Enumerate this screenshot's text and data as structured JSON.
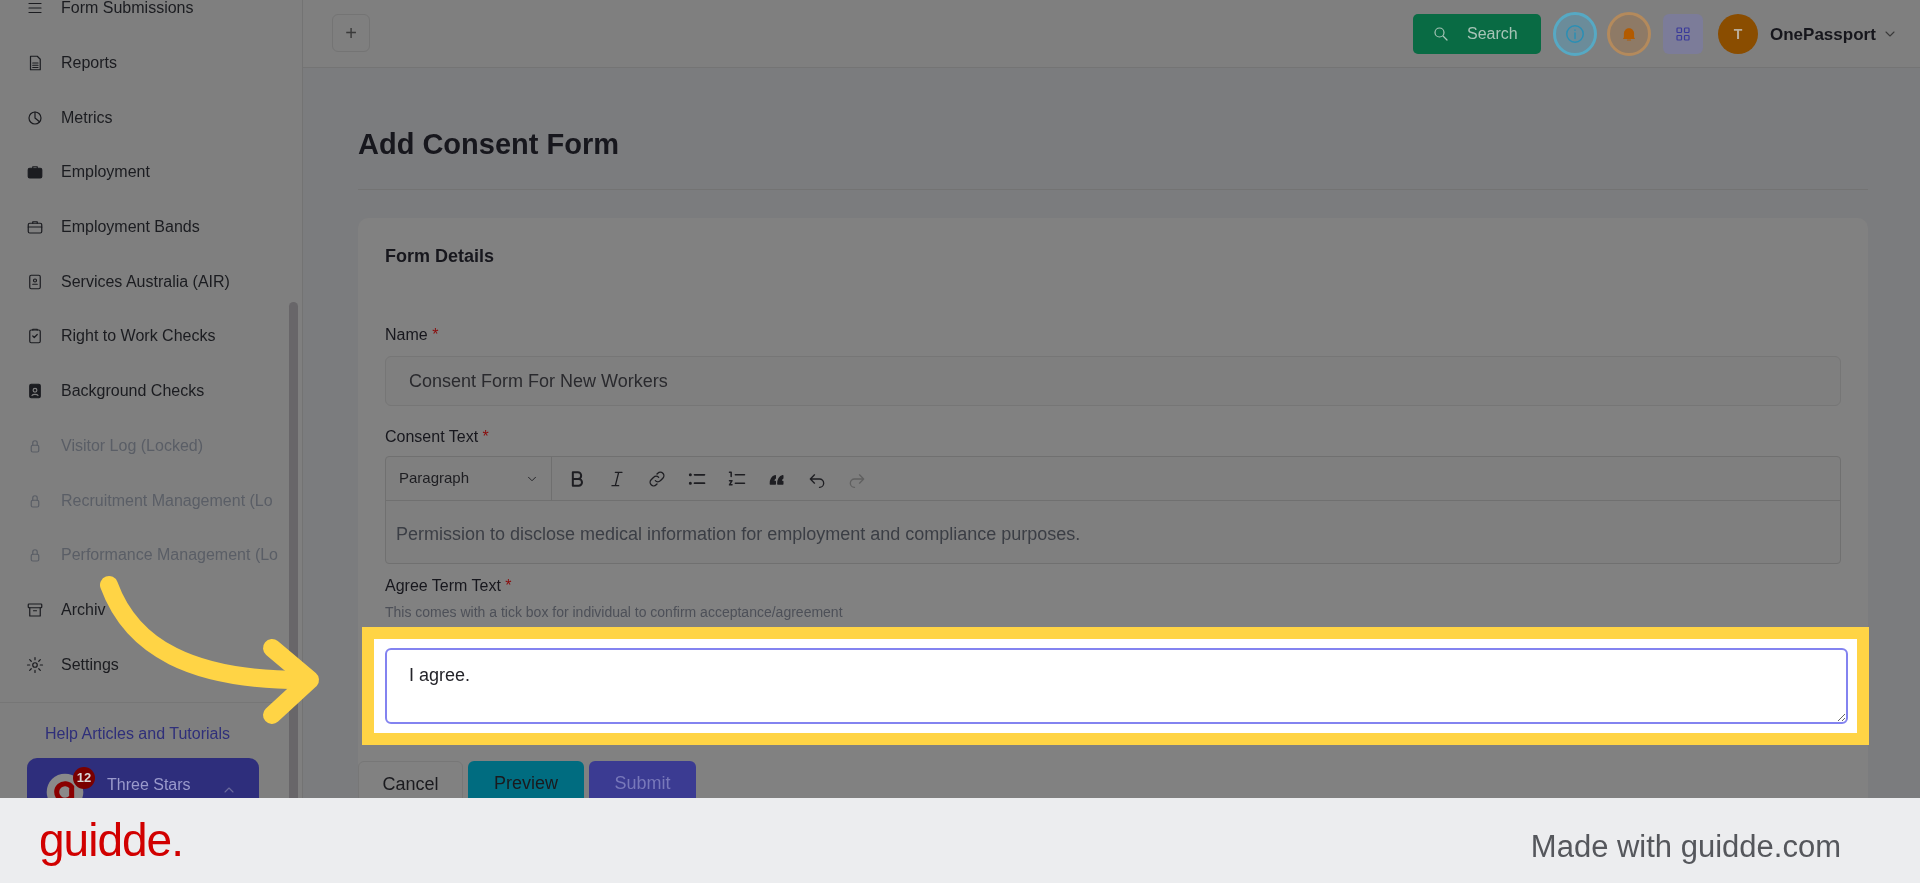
{
  "sidebar": {
    "items": [
      {
        "label": "Form Submissions",
        "locked": false
      },
      {
        "label": "Reports",
        "locked": false
      },
      {
        "label": "Metrics",
        "locked": false
      },
      {
        "label": "Employment",
        "locked": false
      },
      {
        "label": "Employment Bands",
        "locked": false
      },
      {
        "label": "Services Australia (AIR)",
        "locked": false
      },
      {
        "label": "Right to Work Checks",
        "locked": false
      },
      {
        "label": "Background Checks",
        "locked": false
      },
      {
        "label": "Visitor Log (Locked)",
        "locked": true
      },
      {
        "label": "Recruitment Management (Lo",
        "locked": true
      },
      {
        "label": "Performance Management (Lo",
        "locked": true
      },
      {
        "label": "Archiv",
        "locked": false
      },
      {
        "label": "Settings",
        "locked": false
      }
    ],
    "help_link": "Help Articles and Tutorials",
    "account_card": {
      "badge": "12",
      "name": "Three Stars"
    }
  },
  "header": {
    "add_button": "+",
    "search_button": "Search",
    "avatar": "T",
    "account": "OnePassport"
  },
  "page_title": "Add Consent Form",
  "form": {
    "title": "Form Details",
    "name": {
      "label": "Name",
      "required": "*",
      "value": "Consent Form For New Workers"
    },
    "consent": {
      "label": "Consent Text",
      "required": "*",
      "block_style": "Paragraph",
      "text": "Permission to disclose medical information for employment and compliance purposes."
    },
    "agree": {
      "label": "Agree Term Text",
      "required": "*",
      "hint": "This comes with a tick box for individual to confirm acceptance/agreement",
      "value": "I agree."
    },
    "buttons": [
      {
        "label": "Cancel",
        "kind": "plain"
      },
      {
        "label": "Preview",
        "kind": "teal"
      },
      {
        "label": "Submit",
        "kind": "primary"
      }
    ]
  },
  "footer": {
    "logo": "guidde.",
    "credit": "Made with guidde.com"
  }
}
